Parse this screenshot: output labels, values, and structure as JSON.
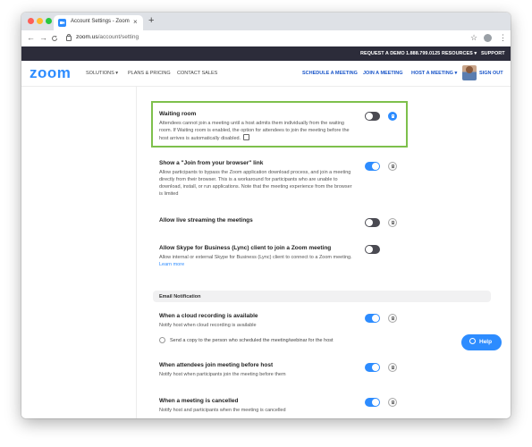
{
  "browser": {
    "tab_title": "Account Settings - Zoom",
    "tab_close": "×",
    "new_tab": "+",
    "back": "←",
    "forward": "→",
    "reload": "C",
    "url_host": "zoom.us",
    "url_path": "/account/setting",
    "star": "☆",
    "menu": "⋮"
  },
  "topbar": {
    "request_demo": "REQUEST A DEMO",
    "phone": "1.888.799.0125",
    "resources": "RESOURCES ▾",
    "support": "SUPPORT"
  },
  "nav": {
    "logo": "zoom",
    "solutions": "SOLUTIONS ▾",
    "plans": "PLANS & PRICING",
    "contact": "CONTACT SALES",
    "schedule": "SCHEDULE A MEETING",
    "join": "JOIN A MEETING",
    "host": "HOST A MEETING ▾",
    "sign_out": "SIGN OUT"
  },
  "settings": [
    {
      "title": "Waiting room",
      "description": "Attendees cannot join a meeting until a host admits them individually from the waiting room. If Waiting room is enabled, the option for attendees to join the meeting before the host arrives is automatically disabled.",
      "enabled": false,
      "locked": true
    },
    {
      "title": "Show a \"Join from your browser\" link",
      "description": "Allow participants to bypass the Zoom application download process, and join a meeting directly from their browser. This is a workaround for participants who are unable to download, install, or run applications. Note that the meeting experience from the browser is limited",
      "enabled": true,
      "locked": false
    },
    {
      "title": "Allow live streaming the meetings",
      "description": "",
      "enabled": false,
      "locked": false
    },
    {
      "title": "Allow Skype for Business (Lync) client to join a Zoom meeting",
      "description": "Allow internal or external Skype for Business (Lync) client to connect to a Zoom meeting.",
      "link": "Learn more",
      "enabled": false,
      "locked": false
    }
  ],
  "email_section": {
    "header": "Email Notification",
    "items": [
      {
        "title": "When a cloud recording is available",
        "description": "Notify host when cloud recording is available",
        "checkbox_label": "Send a copy to the person who scheduled the meeting/webinar for the host",
        "enabled": true,
        "locked": false
      },
      {
        "title": "When attendees join meeting before host",
        "description": "Notify host when participants join the meeting before them",
        "enabled": true,
        "locked": false
      },
      {
        "title": "When a meeting is cancelled",
        "description": "Notify host and participants when the meeting is cancelled",
        "enabled": true,
        "locked": false
      }
    ]
  },
  "help_button": "Help",
  "colors": {
    "brand_blue": "#2d8cff",
    "highlight_green": "#7ec04c",
    "top_bar": "#2c2c3a"
  }
}
